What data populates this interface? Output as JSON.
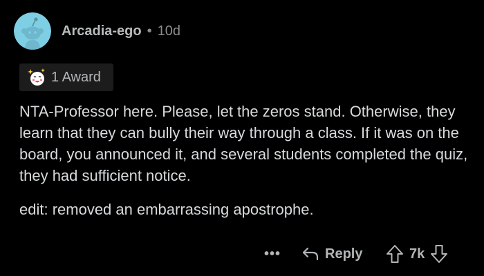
{
  "comment": {
    "username": "Arcadia-ego",
    "separator": "•",
    "time": "10d",
    "award_label": "1 Award",
    "body": [
      "NTA-Professor here.  Please, let the zeros stand. Otherwise, they learn that they can bully their way through a class.  If it was on the board, you announced it, and several students completed the quiz, they had sufficient notice.",
      "edit: removed an embarrassing apostrophe."
    ]
  },
  "actions": {
    "more_label": "•••",
    "reply_label": "Reply",
    "vote_count": "7k"
  },
  "icons": {
    "avatar": "snoo-avatar",
    "award": "wholesome-award-icon",
    "reply": "reply-arrow-icon",
    "upvote": "upvote-arrow-icon",
    "downvote": "downvote-arrow-icon"
  },
  "colors": {
    "background": "#000000",
    "text": "#d7dadc",
    "muted": "#8a8d90",
    "avatar_bg": "#7ecfe4"
  }
}
